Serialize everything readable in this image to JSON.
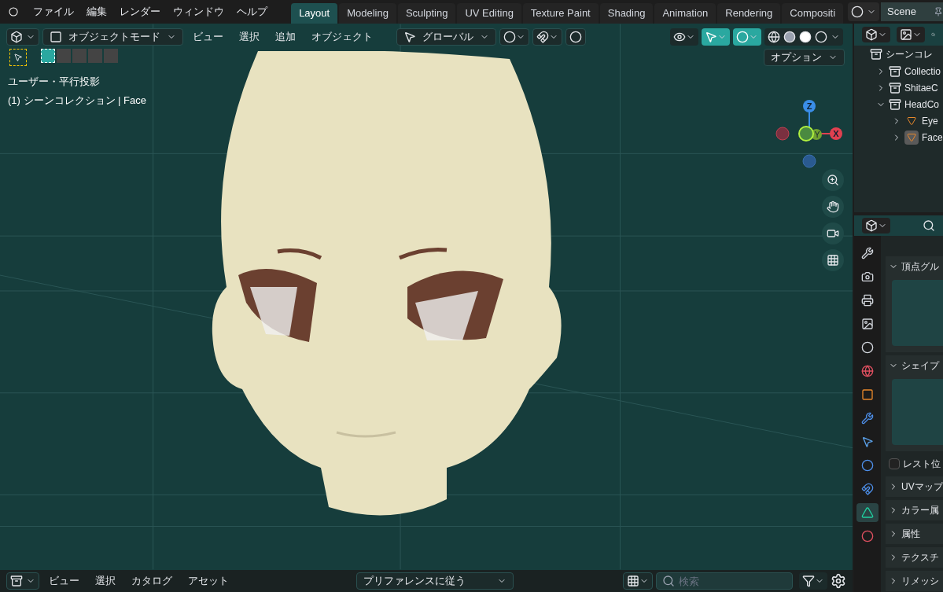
{
  "menu": [
    "ファイル",
    "編集",
    "レンダー",
    "ウィンドウ",
    "ヘルプ"
  ],
  "workspaces": [
    {
      "label": "Layout",
      "selected": true
    },
    {
      "label": "Modeling",
      "selected": false
    },
    {
      "label": "Sculpting",
      "selected": false
    },
    {
      "label": "UV Editing",
      "selected": false
    },
    {
      "label": "Texture Paint",
      "selected": false
    },
    {
      "label": "Shading",
      "selected": false
    },
    {
      "label": "Animation",
      "selected": false
    },
    {
      "label": "Rendering",
      "selected": false
    },
    {
      "label": "Compositi",
      "selected": false
    }
  ],
  "scene": "Scene",
  "viewport": {
    "mode": "オブジェクトモード",
    "menus": [
      "ビュー",
      "選択",
      "追加",
      "オブジェクト"
    ],
    "transform": "グローバル",
    "options": "オプション",
    "info": [
      "ユーザー・平行投影",
      "(1) シーンコレクション | Face"
    ],
    "axes": [
      "Z",
      "Y",
      "X"
    ]
  },
  "outliner": {
    "root": "シーンコレ",
    "items": [
      {
        "name": "Collectio",
        "kind": "collection",
        "expanded": false
      },
      {
        "name": "ShitaeC",
        "kind": "collection",
        "expanded": false
      },
      {
        "name": "HeadCo",
        "kind": "collection",
        "expanded": true,
        "children": [
          {
            "name": "Eye",
            "kind": "mesh",
            "expanded": false,
            "selected": false
          },
          {
            "name": "Face",
            "kind": "mesh",
            "expanded": false,
            "selected": true
          }
        ]
      }
    ]
  },
  "properties": {
    "tabs": [
      {
        "kind": "tool",
        "selected": false
      },
      {
        "kind": "render",
        "selected": false
      },
      {
        "kind": "output",
        "selected": false
      },
      {
        "kind": "view_layer",
        "selected": false
      },
      {
        "kind": "scene",
        "selected": false
      },
      {
        "kind": "world",
        "selected": false
      },
      {
        "kind": "object",
        "selected": false
      },
      {
        "kind": "modifier",
        "selected": false
      },
      {
        "kind": "particles",
        "selected": false
      },
      {
        "kind": "physics",
        "selected": false
      },
      {
        "kind": "constraints",
        "selected": false
      },
      {
        "kind": "data",
        "selected": true
      },
      {
        "kind": "material",
        "selected": false
      }
    ],
    "panels": [
      {
        "title": "頂点グル",
        "expanded": true
      },
      {
        "title": "シェイプ",
        "expanded": true
      }
    ],
    "rest_checkbox": {
      "label": "レスト位",
      "checked": false
    },
    "collapsed": [
      "UVマップ",
      "カラー属",
      "属性",
      "テクスチ",
      "リメッシ"
    ]
  },
  "asset_bar": {
    "menus": [
      "ビュー",
      "選択",
      "カタログ",
      "アセット"
    ],
    "library": "プリファレンスに従う",
    "search": {
      "placeholder": "検索"
    }
  }
}
